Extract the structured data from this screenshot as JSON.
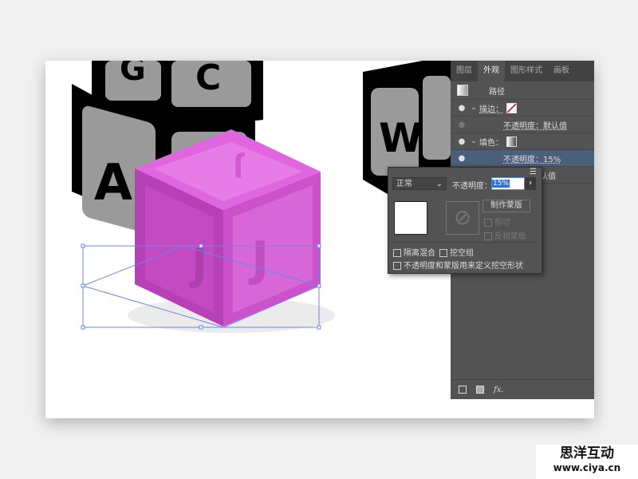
{
  "panel": {
    "tabs": [
      "图层",
      "外观",
      "图形样式",
      "画板"
    ],
    "active_tab": 1,
    "object_label": "路径",
    "rows": [
      {
        "label": "描边：",
        "type": "stroke"
      },
      {
        "label": "不透明度：默认值",
        "type": "opacity"
      },
      {
        "label": "填色：",
        "type": "fill"
      },
      {
        "label": "不透明度：15%",
        "type": "opacity",
        "selected": true
      },
      {
        "label": "认值",
        "type": "opacity"
      }
    ],
    "bottom_icons": [
      "new-stroke-icon",
      "new-fill-icon",
      "fx-icon"
    ],
    "fx_label": "fx."
  },
  "popup": {
    "blend_mode": "正常",
    "opacity_label": "不透明度：",
    "opacity_value": "15%",
    "make_mask": "制作蒙版",
    "clip": "剪切",
    "invert_mask": "反相蒙版",
    "isolate_blending": "隔离混合",
    "knockout_group": "挖空组",
    "opacity_mask_knockout": "不透明度和蒙版用来定义挖空形状"
  },
  "artwork": {
    "letters": [
      "G",
      "C",
      "A",
      "W",
      "J"
    ],
    "cube_color": "#d860d8"
  },
  "watermark": {
    "line1": "思洋互动",
    "line2": "www.ciya.cn"
  }
}
